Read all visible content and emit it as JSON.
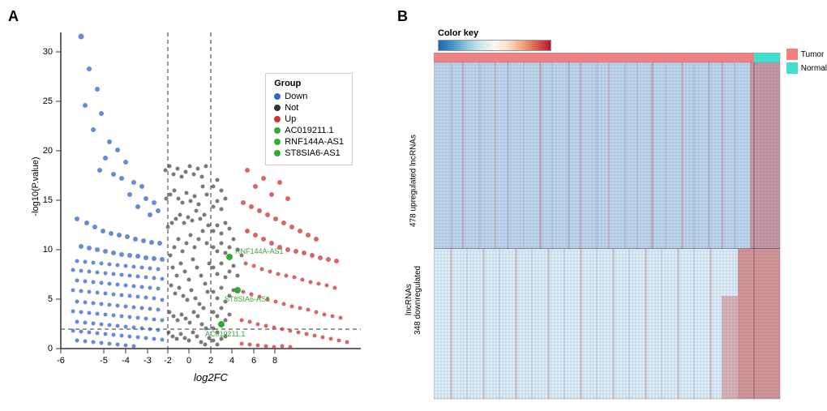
{
  "panels": {
    "a": {
      "label": "A",
      "x_axis": "log2FC",
      "y_axis": "-log10(P.value)",
      "legend": {
        "title": "Group",
        "items": [
          {
            "label": "Down",
            "color": "#3366cc"
          },
          {
            "label": "Not",
            "color": "#333333"
          },
          {
            "label": "Up",
            "color": "#cc3333"
          },
          {
            "label": "AC019211.1",
            "color": "#33aa33"
          },
          {
            "label": "RNF144A-AS1",
            "color": "#33aa33"
          },
          {
            "label": "ST8SIA6-AS1",
            "color": "#33aa33"
          }
        ]
      },
      "dashed_lines": {
        "vertical_left": -1,
        "vertical_right": 1,
        "horizontal": 2
      }
    },
    "b": {
      "label": "B",
      "color_key": {
        "title": "Color key",
        "min": -4,
        "max": 4,
        "ticks": [
          "-4",
          "-2",
          "0",
          "2",
          "4"
        ]
      },
      "heatmap_legend": {
        "items": [
          {
            "label": "Tumor",
            "color": "#f08080"
          },
          {
            "label": "Normal",
            "color": "#40e0d0"
          }
        ]
      },
      "row_labels": {
        "top": "478 upregulated lncRNAs",
        "bottom": "348 downregulated lncRNAs"
      }
    }
  }
}
